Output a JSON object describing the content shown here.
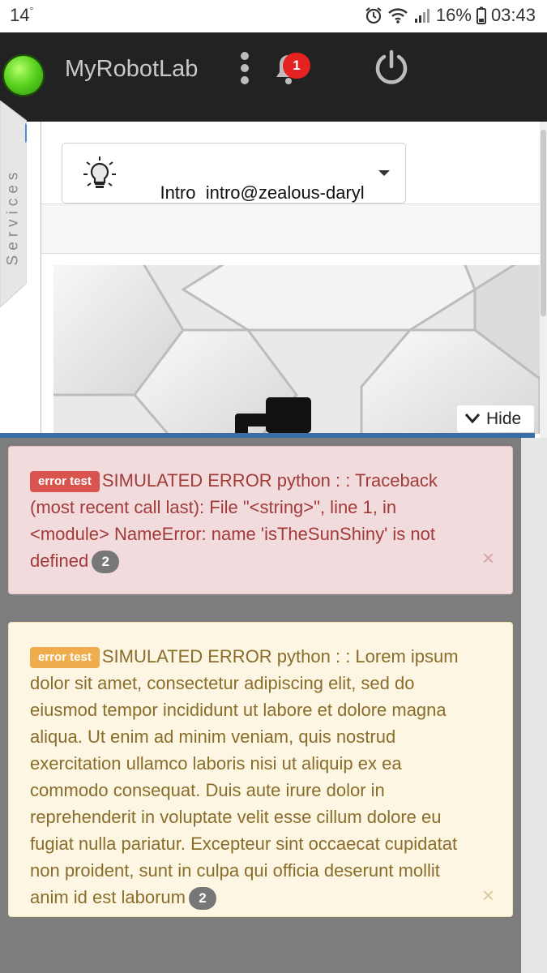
{
  "status_bar": {
    "temperature": "14",
    "temperature_unit": "°",
    "battery": "16%",
    "time": "03:43"
  },
  "app_bar": {
    "title": "MyRobotLab",
    "notification_count": "1"
  },
  "sidebar": {
    "services_label": "Services"
  },
  "service_select": {
    "name": "Intro",
    "id": "intro@zealous-daryl"
  },
  "panel": {
    "hide_label": "Hide"
  },
  "alerts": [
    {
      "tag": "error test",
      "message": "SIMULATED ERROR python : : Traceback (most recent call last): File \"<string>\", line 1, in <module> NameError: name 'isTheSunShiny' is not defined",
      "count": "2",
      "close": "×"
    },
    {
      "tag": "error test",
      "message": "SIMULATED ERROR python : : Lorem ipsum dolor sit amet, consectetur adipiscing elit, sed do eiusmod tempor incididunt ut labore et dolore magna aliqua. Ut enim ad minim veniam, quis nostrud exercitation ullamco laboris nisi ut aliquip ex ea commodo consequat. Duis aute irure dolor in reprehenderit in voluptate velit esse cillum dolore eu fugiat nulla pariatur. Excepteur sint occaecat cupidatat non proident, sunt in culpa qui officia deserunt mollit anim id est laborum",
      "count": "2",
      "close": "×"
    }
  ],
  "colors": {
    "app_bar": "#222222",
    "danger_bg": "#f2dbdc",
    "warning_bg": "#fcf6e2",
    "overlay": "#7d7d7d"
  }
}
